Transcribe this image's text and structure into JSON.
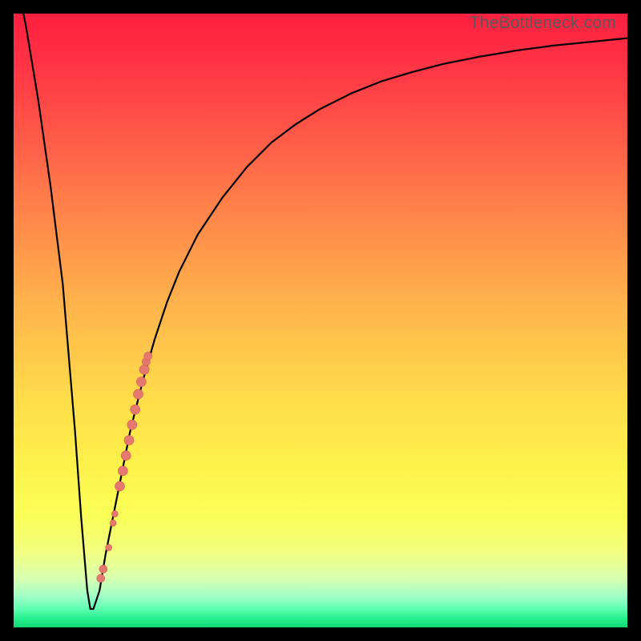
{
  "watermark": "TheBottleneck.com",
  "colors": {
    "frame": "#000000",
    "curve": "#000000",
    "dot": "#e4796f",
    "dot_stroke": "#d95a4f"
  },
  "chart_data": {
    "type": "line",
    "xlabel": "",
    "ylabel": "",
    "xlim": [
      0,
      100
    ],
    "ylim": [
      0,
      100
    ],
    "grid": false,
    "series": [
      {
        "name": "bottleneck-curve",
        "x": [
          0,
          2,
          4,
          6,
          8,
          10,
          11,
          12,
          12.5,
          13,
          14,
          15,
          17,
          19,
          21,
          23,
          25,
          27,
          30,
          34,
          38,
          42,
          46,
          50,
          55,
          60,
          65,
          70,
          76,
          82,
          88,
          94,
          100
        ],
        "y": [
          108,
          98,
          86,
          72,
          56,
          32,
          18,
          6,
          3,
          3,
          6,
          12,
          22,
          32,
          40,
          47,
          53,
          58,
          64,
          70,
          75,
          79,
          82,
          84.5,
          87,
          89,
          90.5,
          91.8,
          93,
          94,
          94.8,
          95.4,
          96
        ]
      }
    ],
    "scatter": {
      "name": "highlight-dots",
      "points": [
        {
          "x": 14.2,
          "y": 8.0,
          "r": 5
        },
        {
          "x": 14.6,
          "y": 9.5,
          "r": 5
        },
        {
          "x": 15.5,
          "y": 13.0,
          "r": 4
        },
        {
          "x": 16.2,
          "y": 17.0,
          "r": 4
        },
        {
          "x": 16.5,
          "y": 18.5,
          "r": 4
        },
        {
          "x": 17.3,
          "y": 23.0,
          "r": 6
        },
        {
          "x": 17.8,
          "y": 25.5,
          "r": 6
        },
        {
          "x": 18.3,
          "y": 28.0,
          "r": 6
        },
        {
          "x": 18.8,
          "y": 30.5,
          "r": 6
        },
        {
          "x": 19.3,
          "y": 33.0,
          "r": 6
        },
        {
          "x": 19.8,
          "y": 35.5,
          "r": 6
        },
        {
          "x": 20.3,
          "y": 38.0,
          "r": 6
        },
        {
          "x": 20.8,
          "y": 40.0,
          "r": 6
        },
        {
          "x": 21.3,
          "y": 42.0,
          "r": 6
        },
        {
          "x": 21.6,
          "y": 43.3,
          "r": 5
        },
        {
          "x": 21.9,
          "y": 44.2,
          "r": 5
        }
      ]
    }
  }
}
